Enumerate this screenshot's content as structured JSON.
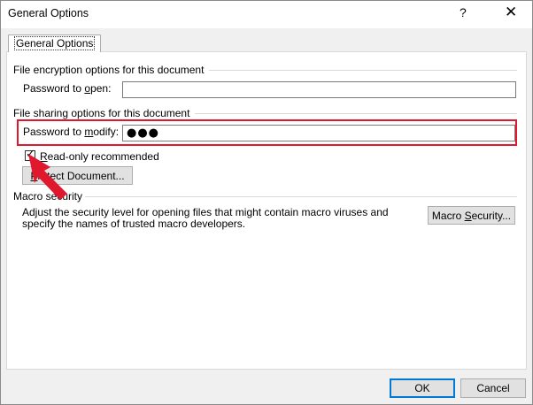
{
  "window": {
    "title": "General Options",
    "help_glyph": "?",
    "close_glyph": "✕"
  },
  "tab": {
    "label": "General Options"
  },
  "encryption": {
    "heading": "File encryption options for this document",
    "label_pre": "Password to ",
    "label_key": "o",
    "label_post": "pen:",
    "value": ""
  },
  "sharing": {
    "heading": "File sharing options for this document",
    "label_pre": "Password to ",
    "label_key": "m",
    "label_post": "odify:",
    "value": "●●●"
  },
  "readonly": {
    "checked": true,
    "check_glyph": "✓",
    "label_key": "R",
    "label_post": "ead-only recommended"
  },
  "protect_button": {
    "pre": "",
    "key": "P",
    "post": "rotect Document..."
  },
  "macro": {
    "heading": "Macro security",
    "description": "Adjust the security level for opening files that might contain macro viruses and specify the names of trusted macro developers.",
    "button_pre": "Macro ",
    "button_key": "S",
    "button_post": "ecurity..."
  },
  "footer": {
    "ok_label": "OK",
    "cancel_label": "Cancel"
  },
  "annotations": {
    "highlight_color": "#e0182e",
    "arrow_color": "#e0182e"
  }
}
